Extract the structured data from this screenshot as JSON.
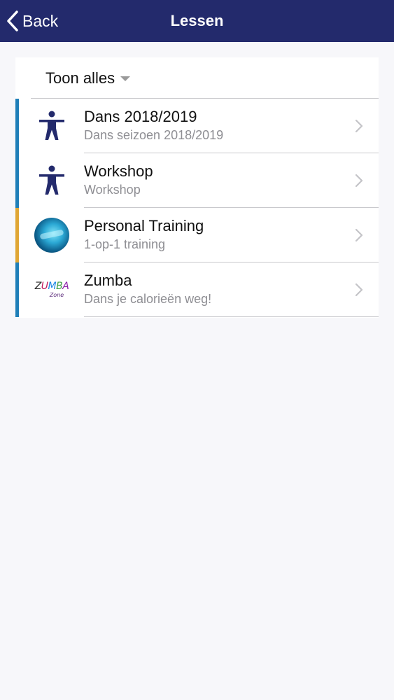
{
  "header": {
    "back_label": "Back",
    "title": "Lessen",
    "background": "#232a6c"
  },
  "filter": {
    "label": "Toon alles"
  },
  "lessons": [
    {
      "title": "Dans 2018/2019",
      "subtitle": "Dans seizoen 2018/2019",
      "icon": "person-icon",
      "accent": "#1f7fb8"
    },
    {
      "title": "Workshop",
      "subtitle": "Workshop",
      "icon": "person-icon",
      "accent": "#1f7fb8"
    },
    {
      "title": "Personal Training",
      "subtitle": "1-op-1 training",
      "icon": "personal-training-avatar",
      "accent": "#e0a634"
    },
    {
      "title": "Zumba",
      "subtitle": "Dans je calorieën weg!",
      "icon": "zumba-logo",
      "logo_text": "ZUMBA",
      "logo_subtext": "Zone",
      "accent": "#1f7fb8"
    }
  ]
}
